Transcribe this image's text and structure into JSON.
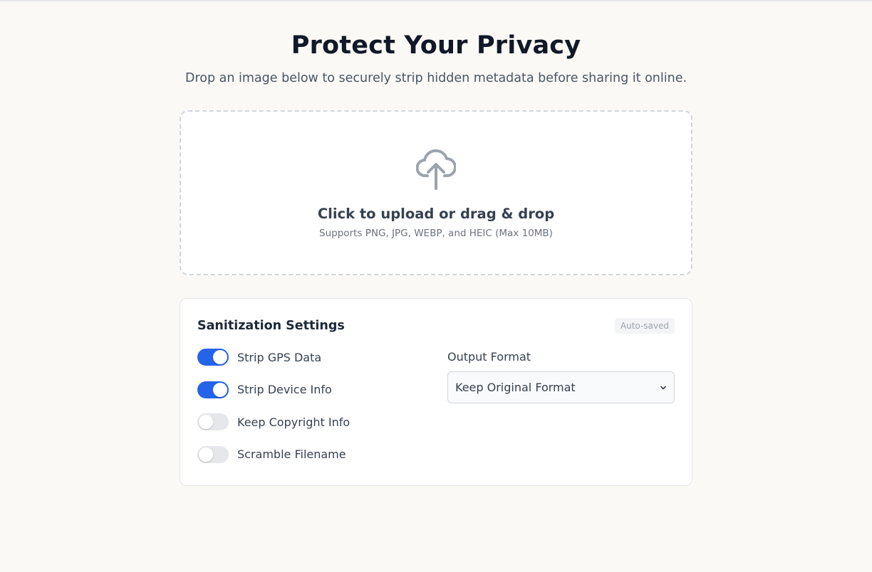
{
  "header": {
    "title": "Protect Your Privacy",
    "subtitle": "Drop an image below to securely strip hidden metadata before sharing it online."
  },
  "dropzone": {
    "icon": "cloud-upload-icon",
    "title": "Click to upload or drag & drop",
    "subtitle": "Supports PNG, JPG, WEBP, and HEIC (Max 10MB)"
  },
  "settings": {
    "title": "Sanitization Settings",
    "badge": "Auto-saved",
    "toggles": [
      {
        "label": "Strip GPS Data",
        "on": true
      },
      {
        "label": "Strip Device Info",
        "on": true
      },
      {
        "label": "Keep Copyright Info",
        "on": false
      },
      {
        "label": "Scramble Filename",
        "on": false
      }
    ],
    "output_format": {
      "label": "Output Format",
      "selected": "Keep Original Format"
    }
  },
  "colors": {
    "accent": "#2563eb",
    "toggle_off": "#e5e7eb",
    "background": "#faf9f6"
  }
}
